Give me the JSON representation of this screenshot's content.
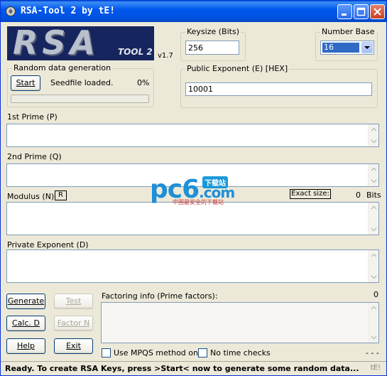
{
  "window": {
    "title": "RSA-Tool 2 by tE!"
  },
  "logo": {
    "text": "RSA",
    "tool_text": "TOOL 2",
    "version": "v1.7"
  },
  "keysize": {
    "label": "Keysize (Bits)",
    "value": "256"
  },
  "number_base": {
    "label": "Number Base",
    "selected": "16"
  },
  "random": {
    "label": "Random data generation",
    "start_label": "Start",
    "seed_status": "Seedfile loaded.",
    "percent": "0%",
    "progress": 0
  },
  "public_exponent": {
    "label": "Public Exponent (E) [HEX]",
    "value": "10001"
  },
  "prime1": {
    "label": "1st Prime (P)",
    "value": ""
  },
  "prime2": {
    "label": "2nd Prime (Q)",
    "value": ""
  },
  "modulus": {
    "label": "Modulus (N)",
    "r_label": "R",
    "exact_size_label": "Exact size:",
    "size_value": "0",
    "size_unit": "Bits",
    "value": ""
  },
  "private_exponent": {
    "label": "Private Exponent (D)",
    "value": ""
  },
  "buttons": {
    "generate": "Generate",
    "test": "Test",
    "calc_d": "Calc. D",
    "factor_n": "Factor N",
    "help": "Help",
    "exit": "Exit"
  },
  "factoring": {
    "label": "Factoring info (Prime factors):",
    "count": "0",
    "value": "",
    "mpqs_label": "Use MPQS method only",
    "no_time_label": "No time checks",
    "timer": "- - -"
  },
  "status": {
    "text": "Ready. To create RSA Keys, press >Start< now to generate some random data...",
    "corner": "tE!"
  },
  "watermark": {
    "text": "pc6",
    "suffix": ".com",
    "tag": "下载站",
    "sub": "中国最安全的下载站"
  },
  "colors": {
    "titlebar": "#0058ee",
    "logo_bg": "#17255e",
    "selection": "#316ac5",
    "face": "#ece9d8"
  }
}
